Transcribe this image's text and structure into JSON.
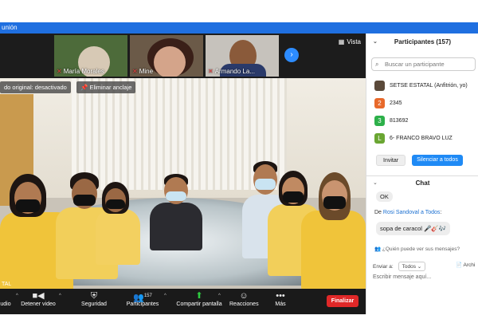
{
  "window": {
    "title_fragment": "unión"
  },
  "thumbnails": [
    {
      "name": "María Morales"
    },
    {
      "name": "Mine"
    },
    {
      "name": "Armando La..."
    }
  ],
  "view_button": "Vista",
  "video_chips": {
    "original": "do original: desactivado",
    "unpin": "Eliminar anclaje"
  },
  "video_label": "TAL",
  "toolbar": {
    "audio": "udio",
    "video": "Detener video",
    "security": "Seguridad",
    "participants": "Participantes",
    "participants_count": "157",
    "share": "Compartir pantalla",
    "reactions": "Reacciones",
    "more": "Más",
    "end": "Finalizar"
  },
  "participants_panel": {
    "title": "Participantes (157)",
    "search_placeholder": "Buscar un participante",
    "items": [
      {
        "avatar": "",
        "label": "SETSE ESTATAL (Anfitrión, yo)",
        "color": "#5b4a3a"
      },
      {
        "avatar": "2",
        "label": "2345",
        "color": "#e8692a"
      },
      {
        "avatar": "3",
        "label": "813692",
        "color": "#2db04a"
      },
      {
        "avatar": "L",
        "label": "6- FRANCO BRAVO LUZ",
        "color": "#6aa632"
      }
    ],
    "invite": "Invitar",
    "mute_all": "Silenciar a todos"
  },
  "chat": {
    "title": "Chat",
    "msg_ok": "OK",
    "from_label": "De ",
    "from_name": "Rosi Sandoval a Todos",
    "from_suffix": ":",
    "message": "sopa de caracol 🎤🎸🎶",
    "who_can_see": "👥 ¿Quién puede ver sus mensajes?",
    "send_to_label": "Enviar a:",
    "send_to_value": "Todos ⌄",
    "file": "📄 Archi",
    "input_placeholder": "Escribir mensaje aquí..."
  }
}
